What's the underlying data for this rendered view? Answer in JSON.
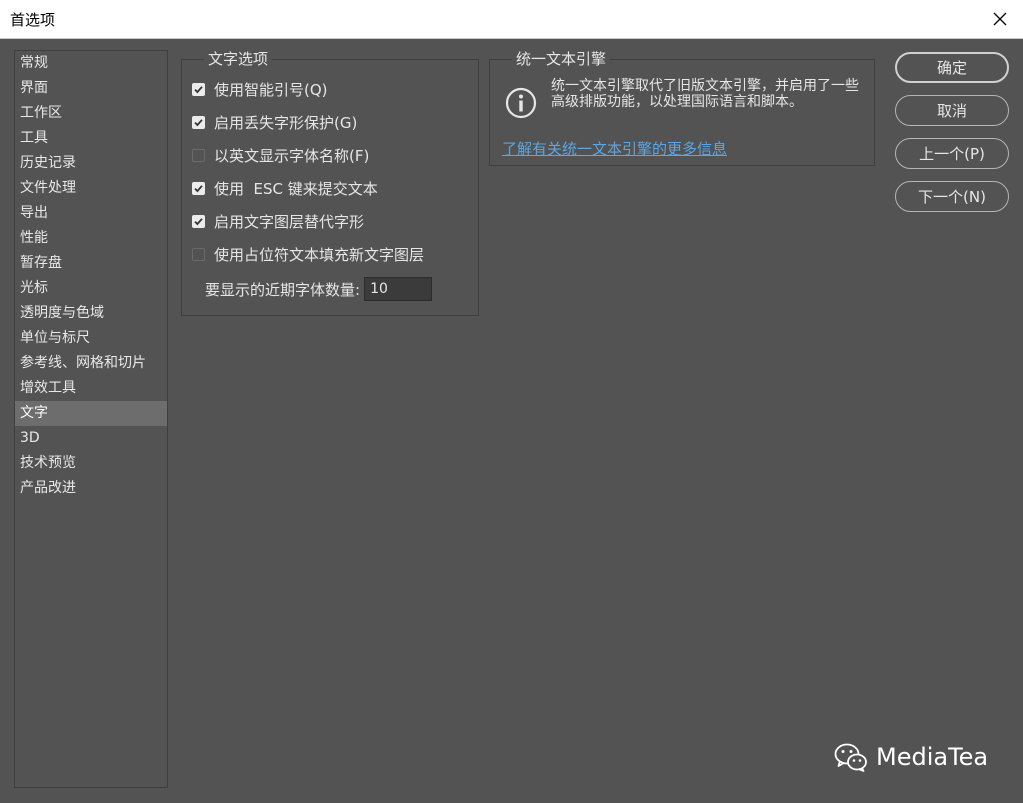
{
  "window": {
    "title": "首选项"
  },
  "sidebar": {
    "items": [
      {
        "label": "常规"
      },
      {
        "label": "界面"
      },
      {
        "label": "工作区"
      },
      {
        "label": "工具"
      },
      {
        "label": "历史记录"
      },
      {
        "label": "文件处理"
      },
      {
        "label": "导出"
      },
      {
        "label": "性能"
      },
      {
        "label": "暂存盘"
      },
      {
        "label": "光标"
      },
      {
        "label": "透明度与色域"
      },
      {
        "label": "单位与标尺"
      },
      {
        "label": "参考线、网格和切片"
      },
      {
        "label": "增效工具"
      },
      {
        "label": "文字",
        "selected": true
      },
      {
        "label": "3D"
      },
      {
        "label": "技术预览"
      },
      {
        "label": "产品改进"
      }
    ]
  },
  "type_options": {
    "legend": "文字选项",
    "checkboxes": [
      {
        "label": "使用智能引号(Q)",
        "checked": true
      },
      {
        "label": "启用丢失字形保护(G)",
        "checked": true
      },
      {
        "label": "以英文显示字体名称(F)",
        "checked": false
      },
      {
        "label": "使用  ESC 键来提交文本",
        "checked": true
      },
      {
        "label": "启用文字图层替代字形",
        "checked": true
      },
      {
        "label": "使用占位符文本填充新文字图层",
        "checked": false
      }
    ],
    "recent_fonts_label": "要显示的近期字体数量:",
    "recent_fonts_value": "10"
  },
  "text_engine": {
    "legend": "统一文本引擎",
    "description": "统一文本引擎取代了旧版文本引擎，并启用了一些高级排版功能，以处理国际语言和脚本。",
    "link": "了解有关统一文本引擎的更多信息"
  },
  "buttons": {
    "ok": "确定",
    "cancel": "取消",
    "prev": "上一个(P)",
    "next": "下一个(N)"
  },
  "watermark": {
    "text": "MediaTea"
  },
  "colors": {
    "background": "#535353",
    "selected_item": "#6d6d6d",
    "link": "#5aa6e6"
  }
}
